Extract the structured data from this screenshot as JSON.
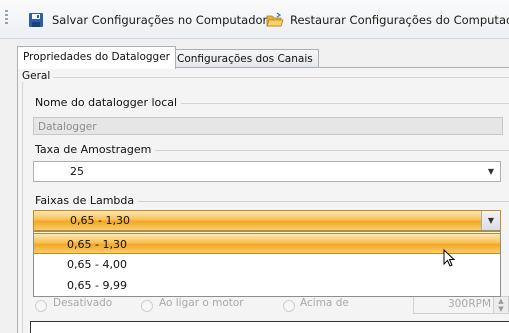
{
  "toolbar": {
    "save_label": "Salvar Configurações no Computador",
    "restore_label": "Restaurar Configurações do Computador"
  },
  "tabs": [
    {
      "label": "Propriedades do Datalogger",
      "active": true
    },
    {
      "label": "Configurações dos Canais",
      "active": false
    }
  ],
  "group": {
    "title": "Geral",
    "name_label": "Nome do datalogger local",
    "name_value": "Datalogger",
    "rate_label": "Taxa de Amostragem",
    "rate_value": "25",
    "lambda_label": "Faixas de Lambda",
    "lambda_value": "0,65 - 1,30"
  },
  "lambda_options": [
    "0,65 - 1,30",
    "0,65 - 4,00",
    "0,65 - 9,99"
  ],
  "highlighted_option": "0,65 - 1,30",
  "obscured_row": {
    "option1": "Desativado",
    "option2": "Ao ligar o motor",
    "option3": "Acima de",
    "rpm_value": "300",
    "rpm_unit": "RPM"
  },
  "colors": {
    "highlight": "#f3a623",
    "accent_border": "#c88a1a"
  },
  "icons": {
    "save": "floppy-disk-icon",
    "restore": "open-folder-icon",
    "cursor": "mouse-pointer-icon"
  }
}
